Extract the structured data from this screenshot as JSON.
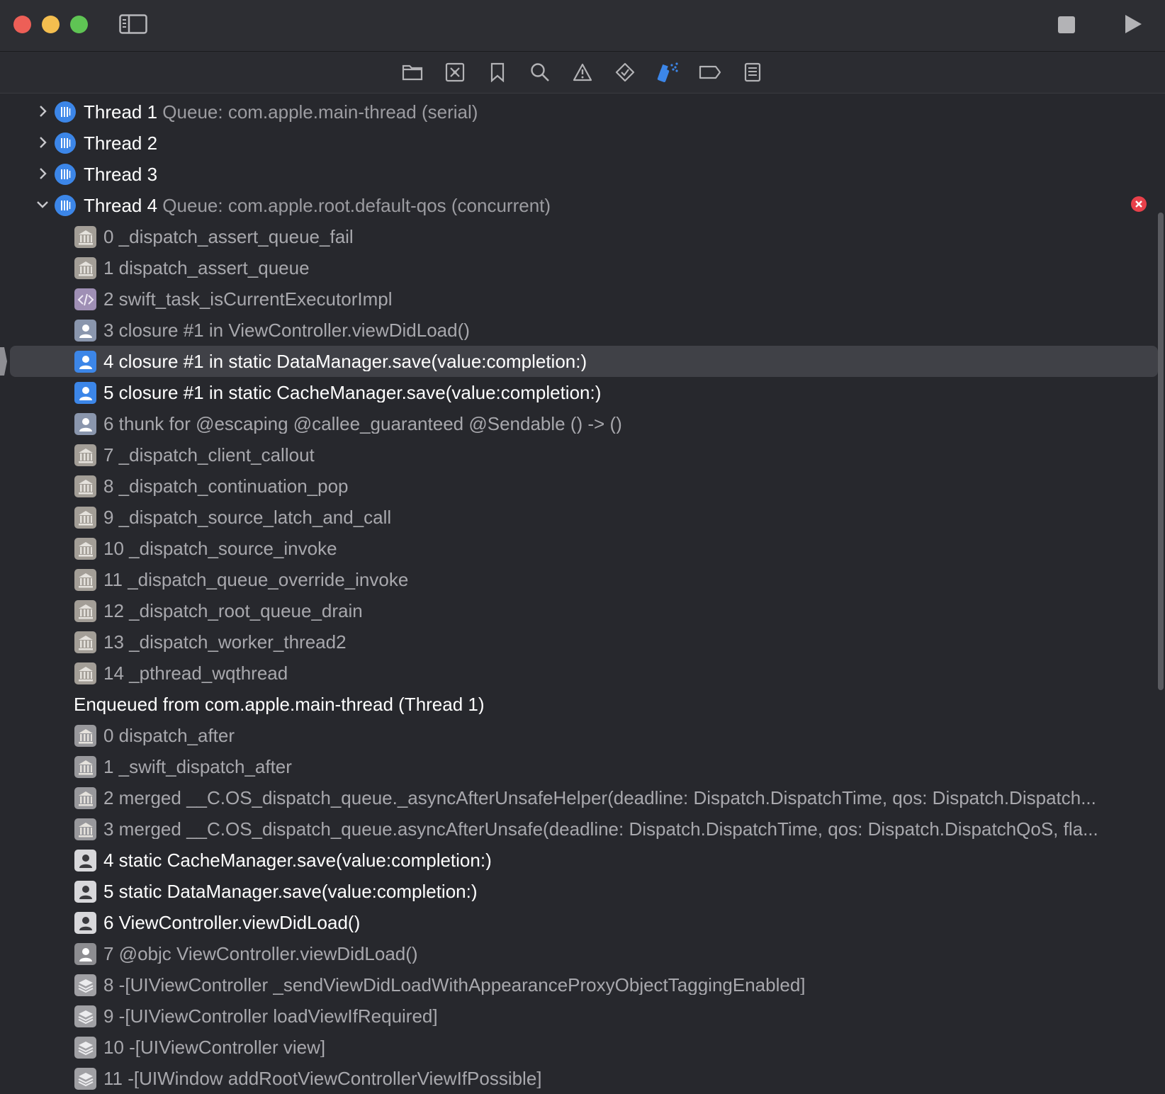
{
  "toolbar": {
    "traffic_lights": [
      "close",
      "minimize",
      "zoom"
    ],
    "icons": [
      "sidebar-toggle-icon",
      "stop-icon",
      "run-icon"
    ]
  },
  "navigator_tabs": [
    {
      "name": "folder-icon",
      "selected": false
    },
    {
      "name": "source-control-icon",
      "selected": false
    },
    {
      "name": "bookmark-icon",
      "selected": false
    },
    {
      "name": "search-icon",
      "selected": false
    },
    {
      "name": "warning-icon",
      "selected": false
    },
    {
      "name": "test-diamond-icon",
      "selected": false
    },
    {
      "name": "debug-spray-icon",
      "selected": true
    },
    {
      "name": "breakpoint-icon",
      "selected": false
    },
    {
      "name": "report-icon",
      "selected": false
    }
  ],
  "threads": [
    {
      "title": "Thread 1",
      "queue": "Queue: com.apple.main-thread (serial)",
      "expanded": false
    },
    {
      "title": "Thread 2",
      "queue": "",
      "expanded": false
    },
    {
      "title": "Thread 3",
      "queue": "",
      "expanded": false
    },
    {
      "title": "Thread 4",
      "queue": "Queue: com.apple.root.default-qos (concurrent)",
      "expanded": true
    }
  ],
  "thread4_frames": [
    {
      "label": "0 _dispatch_assert_queue_fail",
      "icon": "system"
    },
    {
      "label": "1 dispatch_assert_queue",
      "icon": "system"
    },
    {
      "label": "2 swift_task_isCurrentExecutorImpl",
      "icon": "swift"
    },
    {
      "label": "3 closure #1 in ViewController.viewDidLoad()",
      "icon": "user-dim"
    },
    {
      "label": "4 closure #1 in static DataManager.save(value:completion:)",
      "icon": "user",
      "selected": true
    },
    {
      "label": "5 closure #1 in static CacheManager.save(value:completion:)",
      "icon": "user"
    },
    {
      "label": "6 thunk for @escaping @callee_guaranteed @Sendable () -> ()",
      "icon": "user-dim"
    },
    {
      "label": "7 _dispatch_client_callout",
      "icon": "system"
    },
    {
      "label": "8 _dispatch_continuation_pop",
      "icon": "system"
    },
    {
      "label": "9 _dispatch_source_latch_and_call",
      "icon": "system"
    },
    {
      "label": "10 _dispatch_source_invoke",
      "icon": "system"
    },
    {
      "label": "11 _dispatch_queue_override_invoke",
      "icon": "system"
    },
    {
      "label": "12 _dispatch_root_queue_drain",
      "icon": "system"
    },
    {
      "label": "13 _dispatch_worker_thread2",
      "icon": "system"
    },
    {
      "label": "14 _pthread_wqthread",
      "icon": "system"
    }
  ],
  "enqueued_header": "Enqueued from com.apple.main-thread (Thread 1)",
  "enqueued_frames": [
    {
      "label": "0 dispatch_after",
      "icon": "system-gray"
    },
    {
      "label": "1 _swift_dispatch_after",
      "icon": "system-gray"
    },
    {
      "label": "2 merged __C.OS_dispatch_queue._asyncAfterUnsafeHelper(deadline: Dispatch.DispatchTime, qos: Dispatch.Dispatch...",
      "icon": "system-gray"
    },
    {
      "label": "3 merged __C.OS_dispatch_queue.asyncAfterUnsafe(deadline: Dispatch.DispatchTime, qos: Dispatch.DispatchQoS, fla...",
      "icon": "system-gray"
    },
    {
      "label": "4 static CacheManager.save(value:completion:)",
      "icon": "user-white"
    },
    {
      "label": "5 static DataManager.save(value:completion:)",
      "icon": "user-white"
    },
    {
      "label": "6 ViewController.viewDidLoad()",
      "icon": "user-white"
    },
    {
      "label": "7 @objc ViewController.viewDidLoad()",
      "icon": "user-gray"
    },
    {
      "label": "8 -[UIViewController _sendViewDidLoadWithAppearanceProxyObjectTaggingEnabled]",
      "icon": "stack"
    },
    {
      "label": "9 -[UIViewController loadViewIfRequired]",
      "icon": "stack"
    },
    {
      "label": "10 -[UIViewController view]",
      "icon": "stack"
    },
    {
      "label": "11 -[UIWindow addRootViewControllerViewIfPossible]",
      "icon": "stack"
    }
  ],
  "colors": {
    "accent": "#3c86e8",
    "error": "#e8404a",
    "selection": "#404147"
  }
}
